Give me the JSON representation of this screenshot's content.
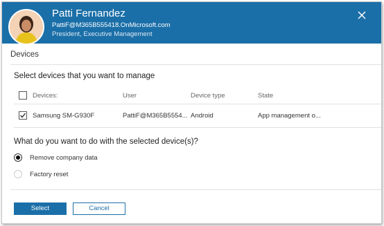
{
  "header": {
    "name": "Patti Fernandez",
    "email": "PattiF@M365B555418.OnMicrosoft.com",
    "title": "President, Executive Management"
  },
  "section_title": "Devices",
  "select_heading": "Select devices that you want to manage",
  "table": {
    "columns": [
      "Devices:",
      "User",
      "Device type",
      "State"
    ],
    "rows": [
      {
        "device": "Samsung SM-G930F",
        "user": "PattiF@M365B5554...",
        "type": "Android",
        "state": "App management o...",
        "checked": true
      }
    ]
  },
  "action_heading": "What do you want to do with the selected device(s)?",
  "options": [
    {
      "label": "Remove company data",
      "selected": true
    },
    {
      "label": "Factory reset",
      "selected": false
    }
  ],
  "buttons": {
    "select": "Select",
    "cancel": "Cancel"
  },
  "colors": {
    "accent": "#1b6fa8"
  }
}
